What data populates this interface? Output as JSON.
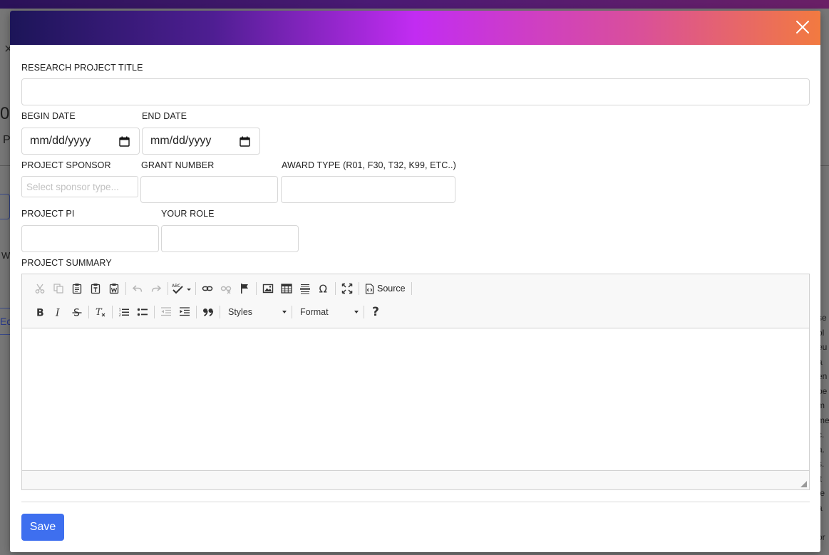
{
  "background": {
    "fragments": [
      "×",
      "0(",
      "P",
      "W",
      "Ed"
    ],
    "right_lines": [
      "se",
      "ol",
      "eu",
      "a",
      "en",
      "pe",
      "m",
      "me",
      "c.",
      "a.",
      "s.",
      "it",
      "te",
      "a",
      "",
      "or"
    ]
  },
  "modal": {
    "close_icon": "close-icon",
    "title_label": "RESEARCH PROJECT TITLE",
    "title_value": "",
    "begin_date_label": "BEGIN DATE",
    "begin_date_value": "mm/dd/yyyy",
    "end_date_label": "END DATE",
    "end_date_value": "mm/dd/yyyy",
    "sponsor_label": "PROJECT SPONSOR",
    "sponsor_placeholder": "Select sponsor type...",
    "grant_label": "GRANT NUMBER",
    "grant_value": "",
    "award_label": "AWARD TYPE (R01, F30, T32, K99, ETC..)",
    "award_value": "",
    "pi_label": "PROJECT PI",
    "pi_value": "",
    "role_label": "YOUR ROLE",
    "role_value": "",
    "summary_label": "PROJECT SUMMARY",
    "save_label": "Save"
  },
  "editor": {
    "source_label": "Source",
    "styles_label": "Styles",
    "format_label": "Format",
    "help_label": "?",
    "toolbar_icons": [
      "cut-icon",
      "copy-icon",
      "paste-icon",
      "paste-text-icon",
      "paste-word-icon",
      "undo-icon",
      "redo-icon",
      "spellcheck-icon",
      "link-icon",
      "unlink-icon",
      "anchor-icon",
      "image-icon",
      "table-icon",
      "horizontal-rule-icon",
      "special-char-icon",
      "maximize-icon",
      "source-icon",
      "bold-icon",
      "italic-icon",
      "strikethrough-icon",
      "remove-format-icon",
      "numbered-list-icon",
      "bulleted-list-icon",
      "outdent-icon",
      "indent-icon",
      "blockquote-icon",
      "help-icon"
    ]
  },
  "colors": {
    "header_gradient": [
      "#1c1558",
      "#4e1e92",
      "#c22cf2",
      "#da5098",
      "#f27a40"
    ],
    "save_button": "#3e6fef"
  }
}
